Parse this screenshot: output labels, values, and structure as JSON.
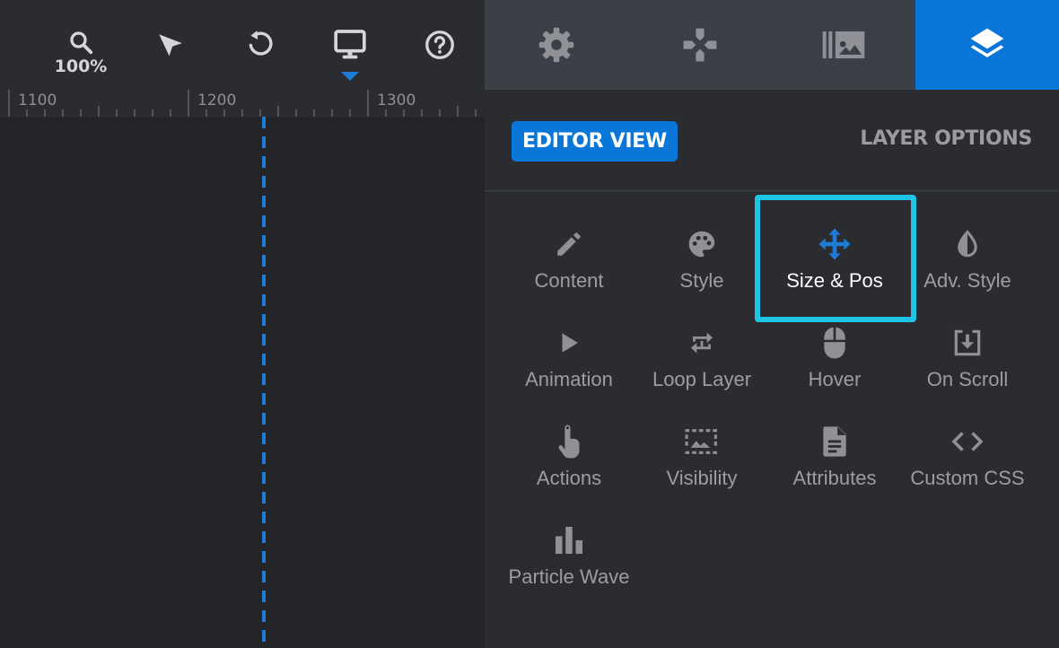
{
  "toolbar": {
    "zoom_label": "100%",
    "tools": [
      {
        "name": "zoom",
        "icon": "search-icon"
      },
      {
        "name": "select",
        "icon": "cursor-arrow-icon"
      },
      {
        "name": "undo",
        "icon": "undo-icon"
      },
      {
        "name": "device",
        "icon": "monitor-icon"
      },
      {
        "name": "help",
        "icon": "help-circle-icon"
      }
    ]
  },
  "ruler": {
    "labels": [
      "1100",
      "1200",
      "1300"
    ]
  },
  "right_tabs": [
    {
      "name": "settings",
      "icon": "gear-icon",
      "active": false
    },
    {
      "name": "navigation",
      "icon": "gamepad-icon",
      "active": false
    },
    {
      "name": "slides",
      "icon": "media-library-icon",
      "active": false
    },
    {
      "name": "layers",
      "icon": "layers-icon",
      "active": true
    }
  ],
  "panel": {
    "editor_view_label": "EDITOR VIEW",
    "layer_options_label": "LAYER OPTIONS",
    "options": [
      {
        "label": "Content",
        "icon": "pencil-icon"
      },
      {
        "label": "Style",
        "icon": "palette-icon"
      },
      {
        "label": "Size & Pos",
        "icon": "move-arrows-icon"
      },
      {
        "label": "Adv. Style",
        "icon": "contrast-drop-icon"
      },
      {
        "label": "Animation",
        "icon": "play-icon"
      },
      {
        "label": "Loop Layer",
        "icon": "loop-icon"
      },
      {
        "label": "Hover",
        "icon": "mouse-icon"
      },
      {
        "label": "On Scroll",
        "icon": "download-box-icon"
      },
      {
        "label": "Actions",
        "icon": "touch-hand-icon"
      },
      {
        "label": "Visibility",
        "icon": "image-frame-icon"
      },
      {
        "label": "Attributes",
        "icon": "document-icon"
      },
      {
        "label": "Custom CSS",
        "icon": "code-icon"
      },
      {
        "label": "Particle Wave",
        "icon": "bar-chart-icon"
      }
    ]
  },
  "colors": {
    "accent": "#0a76d8",
    "highlight": "#1fc4e6",
    "panel_bg": "#2b2c30",
    "canvas_bg": "#232428"
  }
}
